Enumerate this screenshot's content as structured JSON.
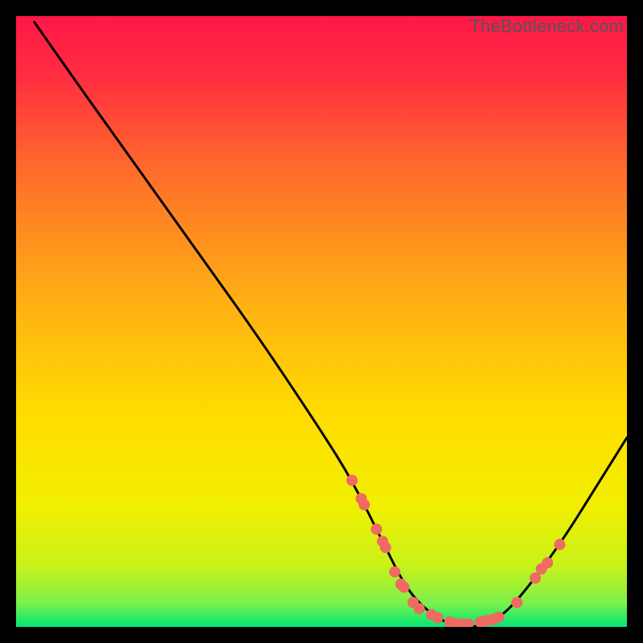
{
  "watermark": "TheBottleneck.com",
  "colors": {
    "gradient_top": "#ff1648",
    "gradient_mid": "#ffdc00",
    "gradient_bottom": "#00e874",
    "curve": "#000000",
    "marker": "#ee6a62",
    "bg": "#000000"
  },
  "chart_data": {
    "type": "line",
    "title": "",
    "xlabel": "",
    "ylabel": "",
    "xlim": [
      0,
      100
    ],
    "ylim": [
      0,
      100
    ],
    "series": [
      {
        "name": "bottleneck-curve",
        "x": [
          3,
          10,
          20,
          30,
          40,
          50,
          55,
          60,
          64,
          68,
          72,
          76,
          80,
          85,
          90,
          95,
          100
        ],
        "y": [
          99,
          89,
          75,
          61,
          47,
          32,
          24,
          14,
          6,
          2,
          0,
          0,
          2,
          8,
          15,
          23,
          31
        ]
      }
    ],
    "markers": [
      {
        "x": 55,
        "y": 24
      },
      {
        "x": 56.5,
        "y": 21
      },
      {
        "x": 57,
        "y": 20
      },
      {
        "x": 59,
        "y": 16
      },
      {
        "x": 60,
        "y": 14
      },
      {
        "x": 60.5,
        "y": 13
      },
      {
        "x": 62,
        "y": 9
      },
      {
        "x": 63,
        "y": 7
      },
      {
        "x": 63.5,
        "y": 6.5
      },
      {
        "x": 65,
        "y": 4
      },
      {
        "x": 66,
        "y": 3
      },
      {
        "x": 68,
        "y": 2
      },
      {
        "x": 69,
        "y": 1.5
      },
      {
        "x": 71,
        "y": 0.8
      },
      {
        "x": 72,
        "y": 0.5
      },
      {
        "x": 73,
        "y": 0.5
      },
      {
        "x": 74,
        "y": 0.5
      },
      {
        "x": 76,
        "y": 0.8
      },
      {
        "x": 77,
        "y": 1
      },
      {
        "x": 78,
        "y": 1.2
      },
      {
        "x": 79,
        "y": 1.6
      },
      {
        "x": 82,
        "y": 4
      },
      {
        "x": 85,
        "y": 8
      },
      {
        "x": 86,
        "y": 9.5
      },
      {
        "x": 87,
        "y": 10.5
      },
      {
        "x": 89,
        "y": 13.5
      }
    ],
    "legend": false,
    "grid": false
  }
}
